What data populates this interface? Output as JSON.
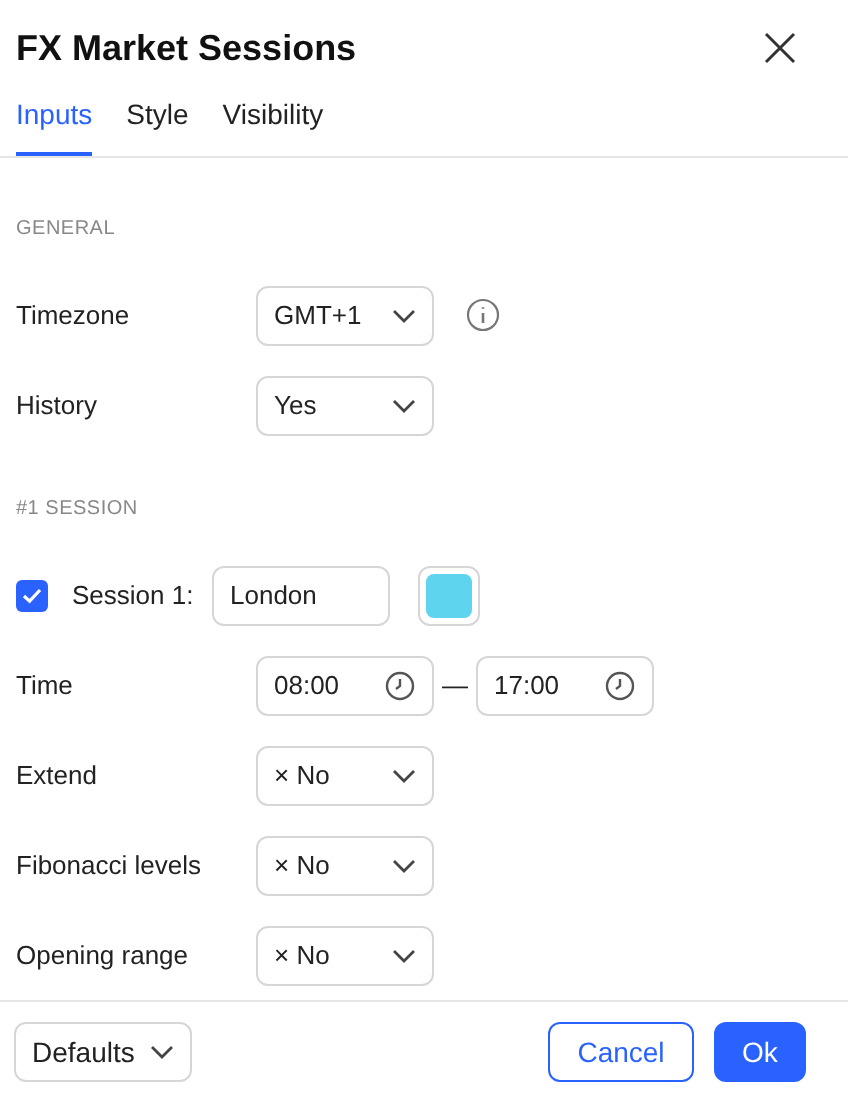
{
  "dialog": {
    "title": "FX Market Sessions"
  },
  "tabs": [
    {
      "label": "Inputs",
      "selected": true
    },
    {
      "label": "Style",
      "selected": false
    },
    {
      "label": "Visibility",
      "selected": false
    }
  ],
  "sections": [
    {
      "heading": "GENERAL",
      "rows": [
        {
          "kind": "select",
          "label": "Timezone",
          "value": "GMT+1",
          "info": true
        },
        {
          "kind": "select",
          "label": "History",
          "value": "Yes",
          "info": false
        }
      ]
    },
    {
      "heading": "#1 SESSION",
      "rows": [
        {
          "kind": "session",
          "label": "Session 1:",
          "checked": true,
          "value": "London",
          "color": "#5fd4ee"
        },
        {
          "kind": "time",
          "label": "Time",
          "start": "08:00",
          "separator": "—",
          "end": "17:00"
        },
        {
          "kind": "select",
          "label": "Extend",
          "value": "× No",
          "info": false
        },
        {
          "kind": "select",
          "label": "Fibonacci levels",
          "value": "× No",
          "info": false
        },
        {
          "kind": "select",
          "label": "Opening range",
          "value": "× No",
          "info": false
        }
      ]
    }
  ],
  "footer": {
    "defaults": "Defaults",
    "cancel": "Cancel",
    "ok": "Ok"
  }
}
